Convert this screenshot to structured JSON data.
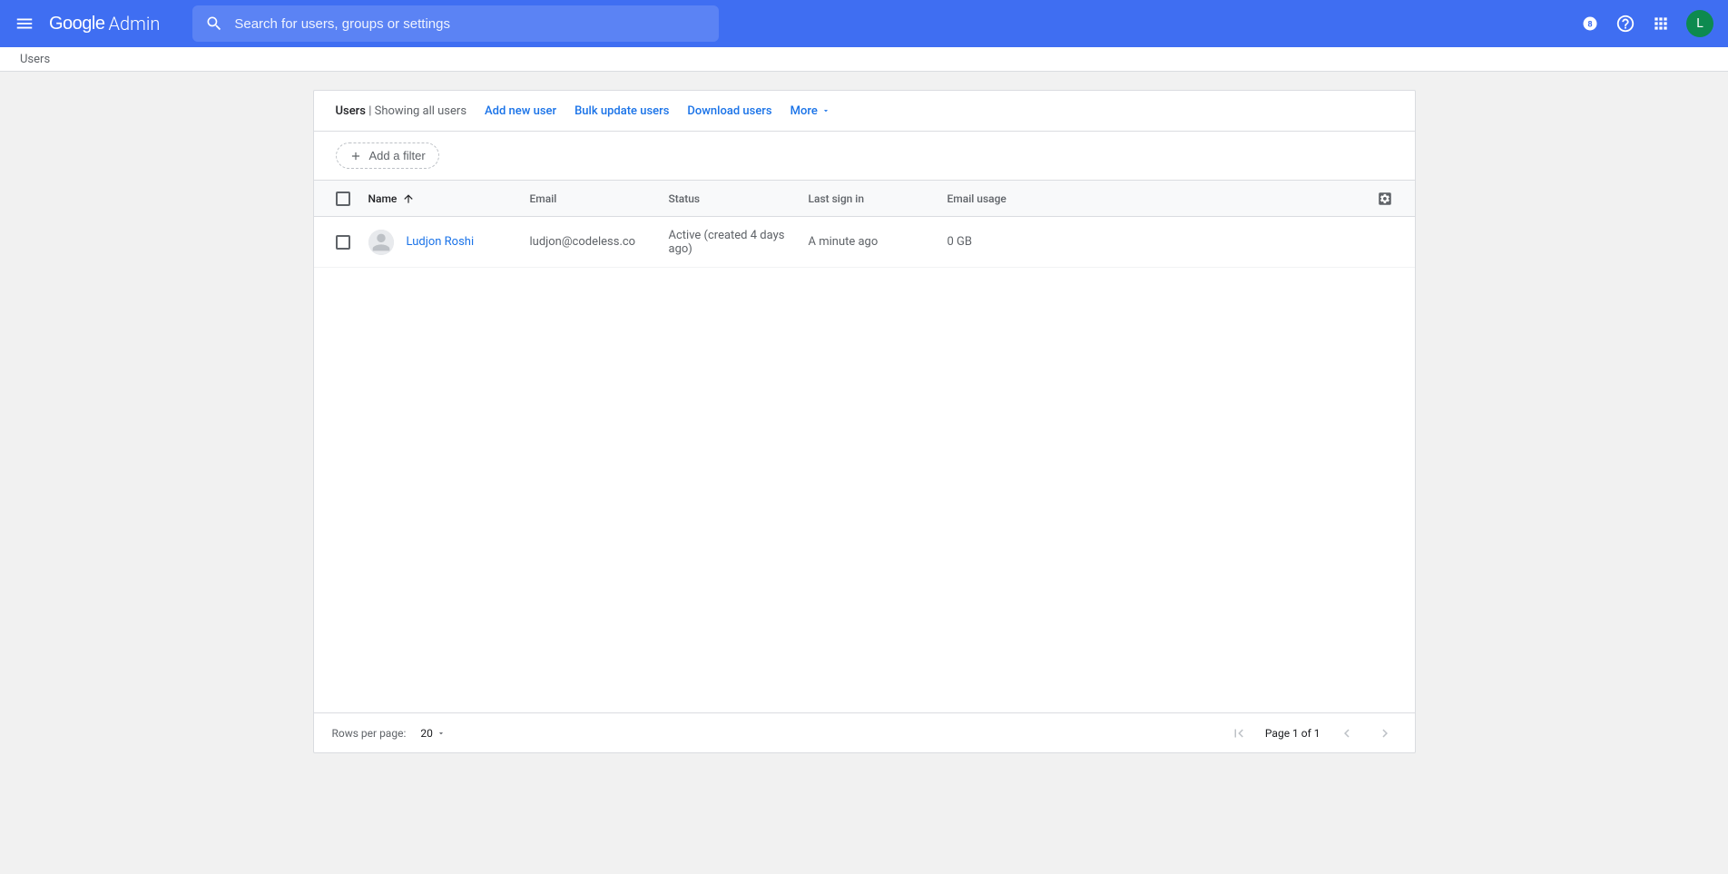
{
  "header": {
    "logo_google": "Google",
    "logo_admin": "Admin",
    "search_placeholder": "Search for users, groups or settings",
    "avatar_letter": "L"
  },
  "breadcrumb": "Users",
  "action_bar": {
    "title": "Users",
    "subtitle": "Showing all users",
    "add_new_user": "Add new user",
    "bulk_update": "Bulk update users",
    "download_users": "Download users",
    "more": "More"
  },
  "filter": {
    "add_filter": "Add a filter"
  },
  "table": {
    "columns": {
      "name": "Name",
      "email": "Email",
      "status": "Status",
      "last_sign_in": "Last sign in",
      "email_usage": "Email usage"
    },
    "rows": [
      {
        "name": "Ludjon Roshi",
        "email": "ludjon@codeless.co",
        "status": "Active (created 4 days ago)",
        "last_sign_in": "A minute ago",
        "email_usage": "0 GB"
      }
    ]
  },
  "footer": {
    "rows_per_page_label": "Rows per page:",
    "rows_per_page_value": "20",
    "page_info": "Page 1 of 1"
  }
}
